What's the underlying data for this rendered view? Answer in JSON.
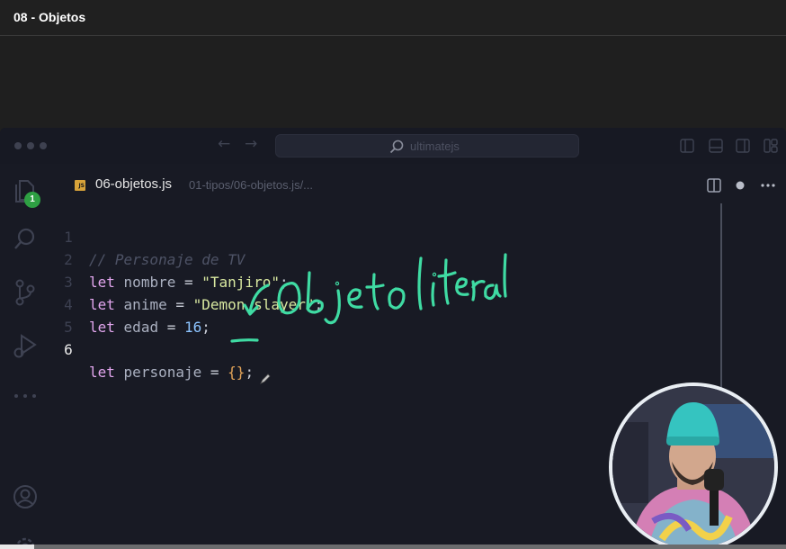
{
  "player": {
    "title": "08 - Objetos",
    "progress_fraction": 0.043
  },
  "editor": {
    "command_center_placeholder": "ultimatejs",
    "activity_bar": {
      "explorer_badge": "1"
    },
    "tab": {
      "file_icon_text": "JS",
      "file_name": "06-objetos.js",
      "path": "01-tipos/06-objetos.js/..."
    },
    "code_lines": [
      {
        "number": "1",
        "comment": "// Personaje de TV"
      },
      {
        "number": "2",
        "keyword": "let",
        "name": "nombre",
        "operator": "=",
        "value": "\"Tanjiro\"",
        "end": ";"
      },
      {
        "number": "3",
        "keyword": "let",
        "name": "anime",
        "operator": "=",
        "value": "\"Demon slayer\"",
        "end": ";"
      },
      {
        "number": "4",
        "keyword": "let",
        "name": "edad",
        "operator": "=",
        "value": "16",
        "end": ";"
      },
      {
        "number": "5"
      },
      {
        "number": "6",
        "keyword": "let",
        "name": "personaje",
        "operator": "=",
        "value": "{}",
        "end": ";"
      }
    ],
    "active_line": "6"
  },
  "annotation": {
    "text": "Objeto literal",
    "color": "#3fdba3"
  },
  "colors": {
    "keyword": "#e2a6ee",
    "string": "#d8e8a0",
    "number": "#8cc4ff",
    "brace": "#e4a458",
    "badge": "#2ea043",
    "beanie": "#35c4c0"
  }
}
